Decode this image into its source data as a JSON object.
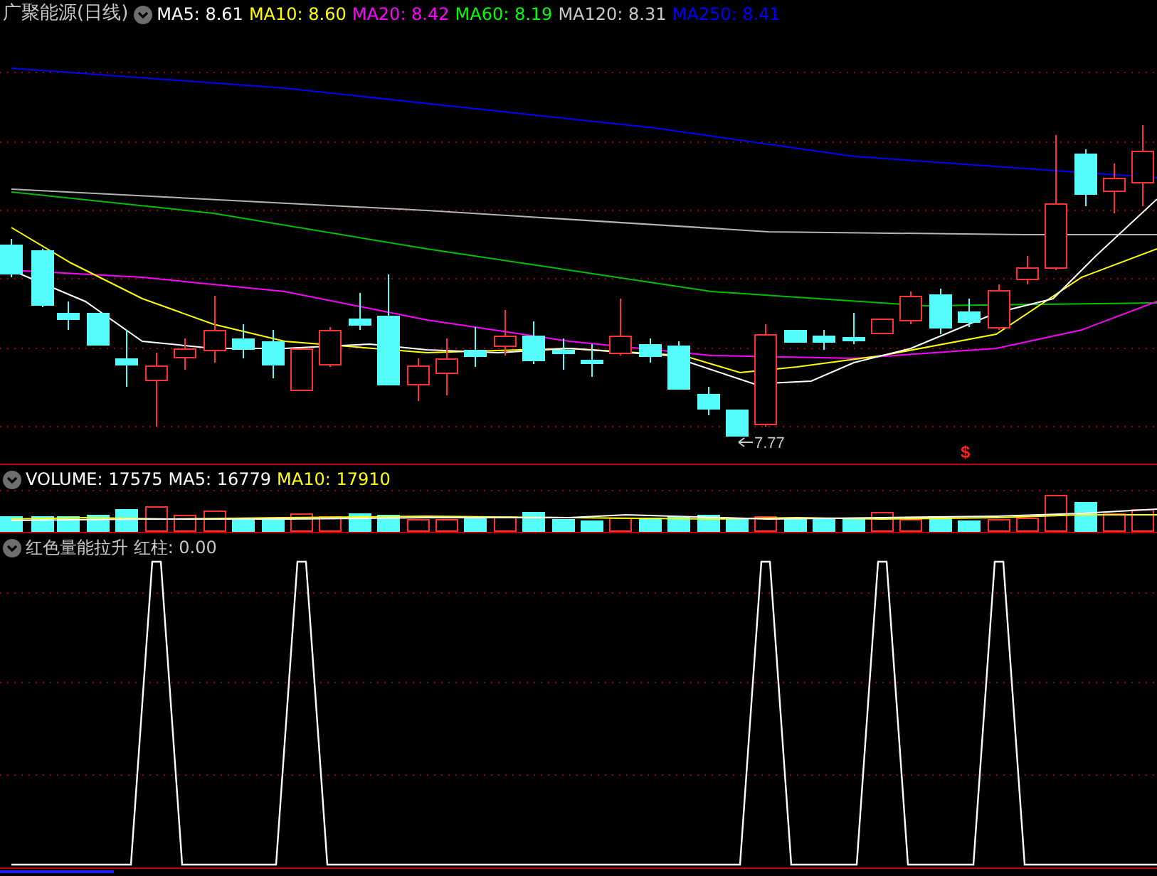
{
  "main_panel": {
    "title": "广聚能源(日线)",
    "legend": [
      {
        "text": "MA5: 8.61",
        "color": "#ffffff"
      },
      {
        "text": "MA10: 8.60",
        "color": "#ffff00"
      },
      {
        "text": "MA20: 8.42",
        "color": "#ff00ff"
      },
      {
        "text": "MA60: 8.19",
        "color": "#00ff00"
      },
      {
        "text": "MA120: 8.31",
        "color": "#c8c8c8"
      },
      {
        "text": "MA250: 8.41",
        "color": "#0000ff"
      }
    ],
    "low_marker": "7.77",
    "signal_marker": "$"
  },
  "volume_panel": {
    "legend": [
      {
        "text": "VOLUME: 17575",
        "color": "#ffffff"
      },
      {
        "text": "MA5: 16779",
        "color": "#ffffff"
      },
      {
        "text": "MA10: 17910",
        "color": "#ffff00"
      }
    ]
  },
  "indicator_panel": {
    "legend": [
      {
        "text": "红色量能拉升 红柱: 0.00",
        "color": "#c8c8c8"
      }
    ]
  }
}
